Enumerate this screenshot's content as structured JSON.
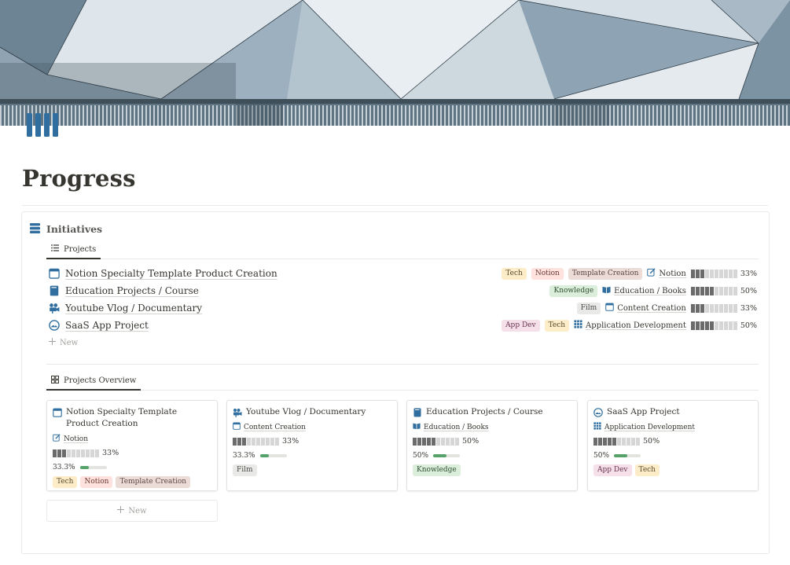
{
  "page": {
    "title": "Progress"
  },
  "database": {
    "title": "Initiatives",
    "list_tab": "Projects",
    "gallery_tab": "Projects Overview",
    "new_label": "New",
    "rows": [
      {
        "name": "Notion Specialty Template Product Creation",
        "icon": "calendar-icon",
        "tags": [
          {
            "label": "Tech",
            "cls": "t-tech"
          },
          {
            "label": "Notion",
            "cls": "t-notion"
          },
          {
            "label": "Template Creation",
            "cls": "t-template"
          }
        ],
        "area": "Notion",
        "area_icon": "edit-icon",
        "progress_label": "33%",
        "progress": 0.33
      },
      {
        "name": "Education Projects / Course",
        "icon": "book-icon",
        "tags": [
          {
            "label": "Knowledge",
            "cls": "t-knowledge"
          }
        ],
        "area": "Education / Books",
        "area_icon": "open-book-icon",
        "progress_label": "50%",
        "progress": 0.5
      },
      {
        "name": "Youtube Vlog / Documentary",
        "icon": "video-camera-icon",
        "tags": [
          {
            "label": "Film",
            "cls": "t-film"
          }
        ],
        "area": "Content Creation",
        "area_icon": "calendar-icon",
        "progress_label": "33%",
        "progress": 0.33
      },
      {
        "name": "SaaS App Project",
        "icon": "dashboard-icon",
        "tags": [
          {
            "label": "App Dev",
            "cls": "t-appdev"
          },
          {
            "label": "Tech",
            "cls": "t-tech"
          }
        ],
        "area": "Application Development",
        "area_icon": "grid-icon",
        "progress_label": "50%",
        "progress": 0.5
      }
    ],
    "cards": [
      {
        "title": "Notion Specialty Template Product Creation",
        "icon": "calendar-icon",
        "area": "Notion",
        "area_icon": "edit-icon",
        "progress_label": "33%",
        "progress": 0.33,
        "percent_text": "33.3%",
        "percent": 0.333,
        "tags": [
          {
            "label": "Tech",
            "cls": "t-tech"
          },
          {
            "label": "Notion",
            "cls": "t-notion"
          },
          {
            "label": "Template Creation",
            "cls": "t-template"
          }
        ]
      },
      {
        "title": "Youtube Vlog / Documentary",
        "icon": "video-camera-icon",
        "area": "Content Creation",
        "area_icon": "calendar-icon",
        "progress_label": "33%",
        "progress": 0.33,
        "percent_text": "33.3%",
        "percent": 0.333,
        "tags": [
          {
            "label": "Film",
            "cls": "t-film"
          }
        ]
      },
      {
        "title": "Education Projects / Course",
        "icon": "book-icon",
        "area": "Education / Books",
        "area_icon": "open-book-icon",
        "progress_label": "50%",
        "progress": 0.5,
        "percent_text": "50%",
        "percent": 0.5,
        "tags": [
          {
            "label": "Knowledge",
            "cls": "t-knowledge"
          }
        ]
      },
      {
        "title": "SaaS App Project",
        "icon": "dashboard-icon",
        "area": "Application Development",
        "area_icon": "grid-icon",
        "progress_label": "50%",
        "progress": 0.5,
        "percent_text": "50%",
        "percent": 0.5,
        "tags": [
          {
            "label": "App Dev",
            "cls": "t-appdev"
          },
          {
            "label": "Tech",
            "cls": "t-tech"
          }
        ]
      }
    ]
  },
  "colors": {
    "accent_blue": "#2f6e9e",
    "progress_on": "#6b6b6b",
    "progress_off": "#d6d6d6",
    "mini_bar": "#55a26a"
  }
}
